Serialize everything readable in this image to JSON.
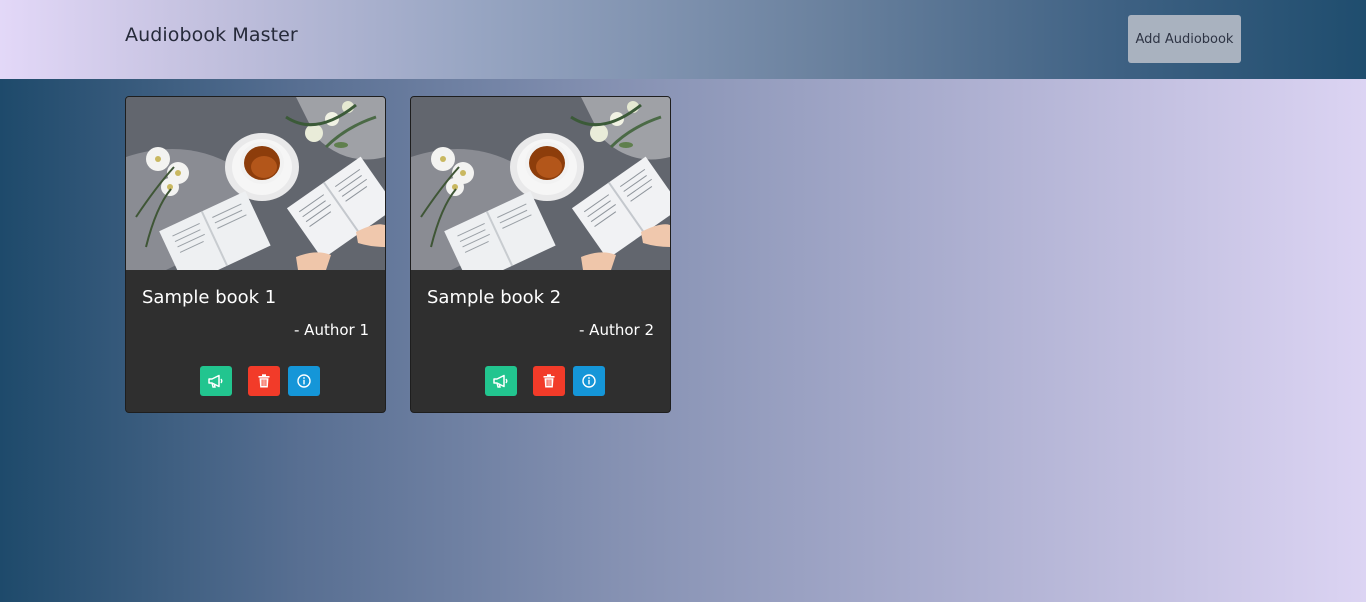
{
  "header": {
    "brand": "Audiobook Master",
    "add_button_label": "Add Audiobook"
  },
  "books": [
    {
      "title": "Sample book 1",
      "author": "- Author 1",
      "image_alt": "tea cup and open books"
    },
    {
      "title": "Sample book 2",
      "author": "- Author 2",
      "image_alt": "tea cup and open books"
    }
  ],
  "actions": {
    "announce_icon": "megaphone-icon",
    "delete_icon": "trash-icon",
    "info_icon": "info-circle-icon"
  },
  "colors": {
    "card_bg": "#2f2f2f",
    "announce": "#22c58f",
    "delete": "#f23b29",
    "info": "#1596d8",
    "add_button": "#a9b2bf"
  }
}
